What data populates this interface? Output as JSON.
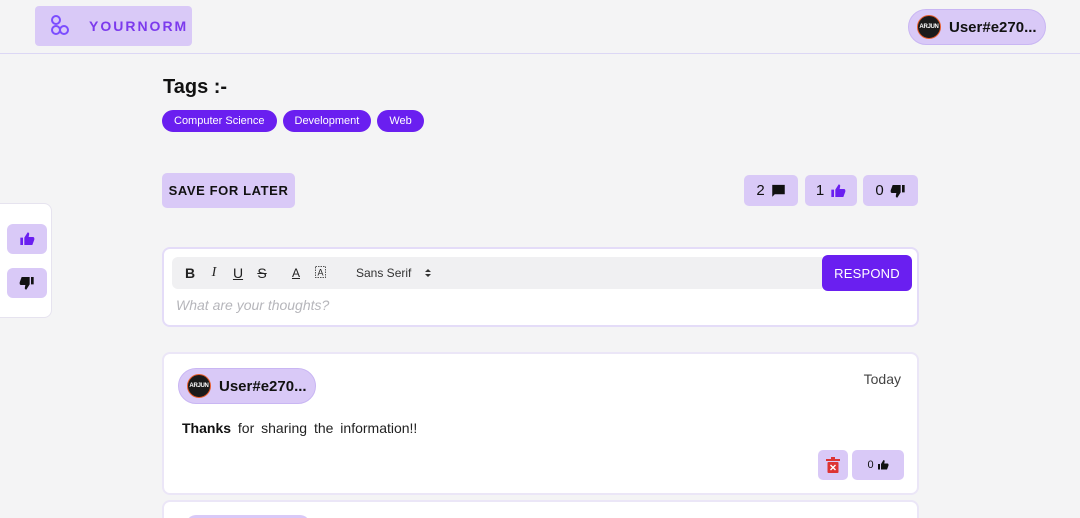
{
  "header": {
    "brand": "YOURNORM",
    "user": {
      "avatar_text": "ARJUN",
      "name": "User#e270..."
    }
  },
  "tags": {
    "title": "Tags :-",
    "items": [
      "Computer Science",
      "Development",
      "Web"
    ]
  },
  "actions": {
    "save_label": "SAVE FOR LATER",
    "comments_count": "2",
    "likes_count": "1",
    "dislikes_count": "0"
  },
  "editor": {
    "bold": "B",
    "italic": "I",
    "underline": "U",
    "strike": "S",
    "font_color": "A",
    "font": "Sans Serif",
    "placeholder": "What are your thoughts?",
    "respond_label": "RESPOND"
  },
  "comments": [
    {
      "avatar_text": "ARJUN",
      "user": "User#e270...",
      "date": "Today",
      "text_bold": "Thanks",
      "text_rest": "for sharing the information!!",
      "likes": "0"
    }
  ],
  "colors": {
    "accent": "#6a1ff0",
    "accent_light": "#d9c9f7",
    "background": "#f4f4f5"
  }
}
